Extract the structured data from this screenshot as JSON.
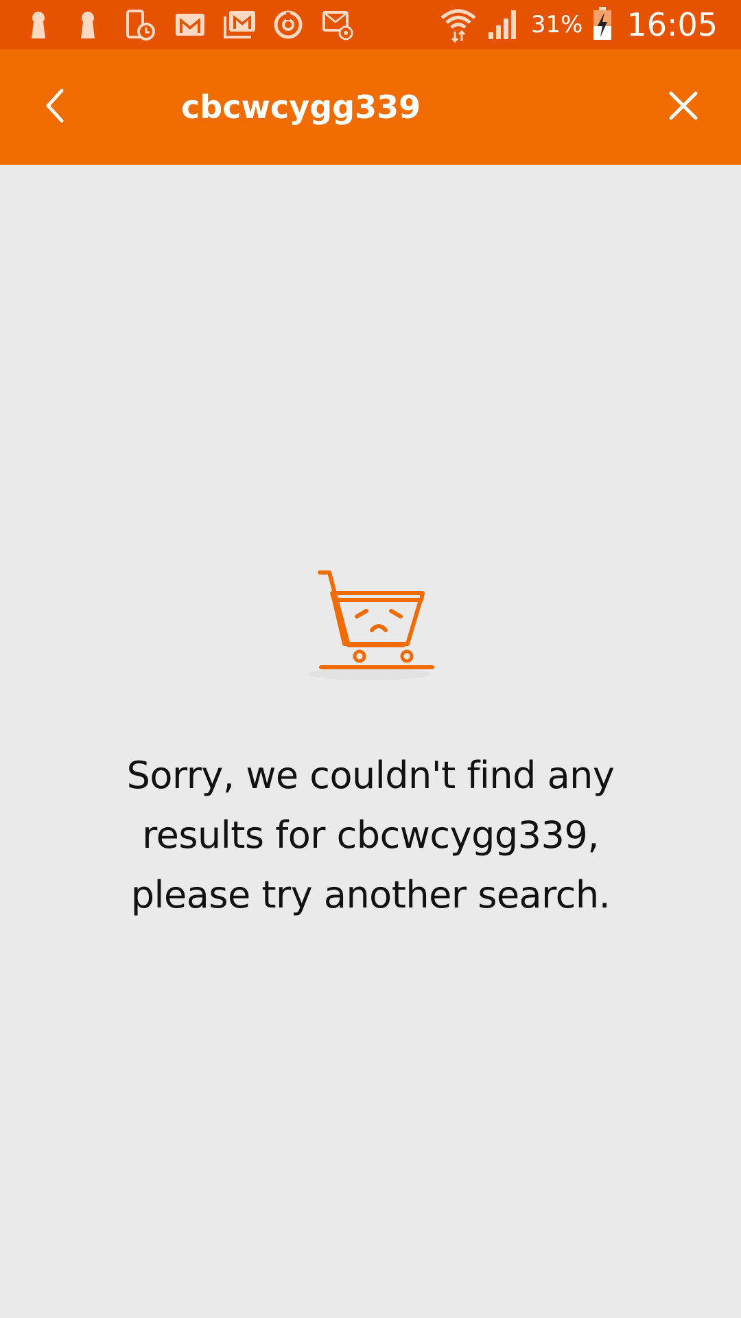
{
  "status_bar": {
    "left_icons": [
      "keyhole-icon",
      "keyhole-icon",
      "phone-clock-icon",
      "gmail-icon",
      "gmail-stack-icon",
      "sync-icon",
      "email-at-icon"
    ],
    "right_icons": [
      "wifi-icon",
      "signal-icon",
      "battery-charging-icon"
    ],
    "battery_percent": "31%",
    "time": "16:05"
  },
  "app_bar": {
    "title": "cbcwcygg339",
    "back_icon": "chevron-left-icon",
    "close_icon": "close-icon"
  },
  "empty_state": {
    "icon": "sad-cart-icon",
    "line1": "Sorry, we couldn't find any",
    "line2": "results for cbcwcygg339,",
    "line3": "please try another search."
  },
  "colors": {
    "status_bar": "#E55300",
    "app_bar": "#F06C00",
    "background": "#EAEAEB",
    "accent": "#F06C00",
    "text": "#111111"
  }
}
